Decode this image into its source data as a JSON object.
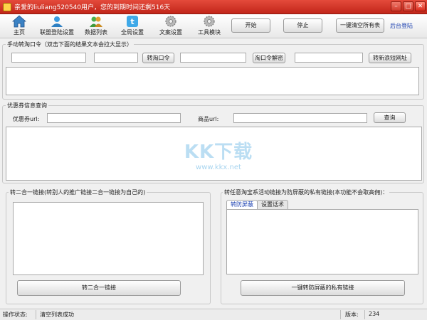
{
  "window": {
    "title": "亲爱的liuliang520540用户，您的到期时间还剩516天",
    "minimize": "–",
    "maximize": "□",
    "close": "✕"
  },
  "toolbar": {
    "items": [
      {
        "label": "主页",
        "icon": "home-icon"
      },
      {
        "label": "联盟登陆设置",
        "icon": "user-icon"
      },
      {
        "label": "数据列表",
        "icon": "users-icon"
      },
      {
        "label": "全局设置",
        "icon": "twitter-icon"
      },
      {
        "label": "文案设置",
        "icon": "gear-icon"
      },
      {
        "label": "工具模块",
        "icon": "gear-icon"
      }
    ],
    "start": "开始",
    "stop": "停止",
    "clear_all": "一键清空所有表",
    "backend_login": "后台登陆"
  },
  "taokouling": {
    "group_label": "手动转淘口令（双击下面的结果文本会拉大显示）",
    "btn_convert": "转淘口令",
    "btn_decode": "淘口令解密",
    "btn_short_url": "转新浪短网址"
  },
  "coupon": {
    "group_label": "优惠券信息查询",
    "coupon_url_label": "优惠券url:",
    "product_url_label": "商品url:",
    "btn_query": "查询"
  },
  "two_in_one": {
    "group_label": "转二合一链接(转别人的推广链接二合一链接为自己的)",
    "btn_convert": "转二合一链接"
  },
  "private_link": {
    "group_label": "转任意淘宝系活动链接为防屏蔽的私有链接(本功能不会取高佣)：",
    "tabs": [
      "转防屏蔽",
      "设置话术"
    ],
    "active_tab": 0,
    "btn_convert": "一键转防屏蔽的私有链接"
  },
  "watermark": {
    "main": "KK下载",
    "sub": "www.kkx.net"
  },
  "status": {
    "label": "操作状态:",
    "value": "清空列表成功",
    "version_label": "版本:",
    "version_value": "234"
  },
  "colors": {
    "title_bar": "#d0392b",
    "link": "#1a3fb0",
    "watermark": "#3ca0dc"
  }
}
